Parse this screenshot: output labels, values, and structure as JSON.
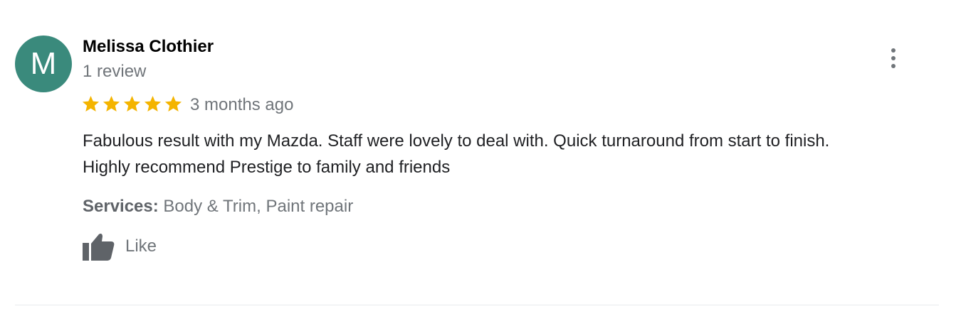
{
  "review": {
    "author": {
      "initial": "M",
      "name": "Melissa Clothier",
      "review_count": "1 review",
      "avatar_color": "#3a8a7c"
    },
    "rating": 5,
    "rating_max": 5,
    "date": "3 months ago",
    "text_line1": "Fabulous result with my Mazda. Staff were lovely to deal with. Quick turnaround from start to finish.",
    "text_line2": "Highly recommend Prestige to family and friends",
    "services_label": "Services:",
    "services_value": "Body & Trim, Paint repair",
    "like_label": "Like",
    "menu_icon": "more-vert-icon",
    "like_icon": "thumb-up-icon",
    "star_color": "#f4b400"
  }
}
